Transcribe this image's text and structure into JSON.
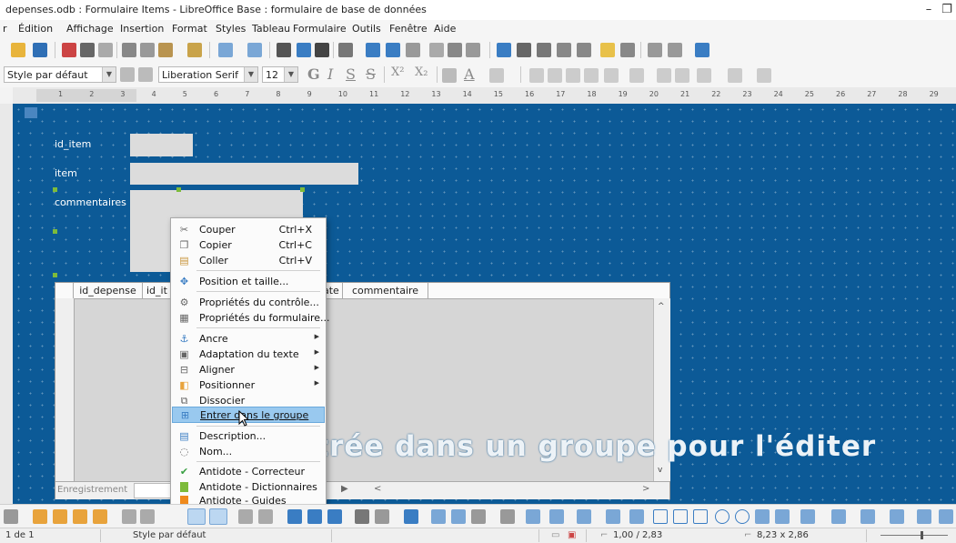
{
  "window": {
    "title": "depenses.odb : Formulaire Items - LibreOffice Base : formulaire de base de données"
  },
  "menubar": [
    "r",
    "Édition",
    "Affichage",
    "Insertion",
    "Format",
    "Styles",
    "Tableau",
    "Formulaire",
    "Outils",
    "Fenêtre",
    "Aide"
  ],
  "formatting": {
    "paragraph_style": "Style par défaut",
    "font_name": "Liberation Serif",
    "font_size": "12"
  },
  "ruler_ticks": [
    "1",
    "2",
    "3",
    "4",
    "5",
    "6",
    "7",
    "8",
    "9",
    "10",
    "11",
    "12",
    "13",
    "14",
    "15",
    "16",
    "17",
    "18",
    "19",
    "20",
    "21",
    "22",
    "23",
    "24",
    "25",
    "26",
    "27",
    "28",
    "29"
  ],
  "form": {
    "label_id_item": "id_item",
    "label_item": "item",
    "label_commentaires": "commentaires"
  },
  "grid": {
    "columns": [
      "id_depense",
      "id_it",
      "ate",
      "commentaire"
    ],
    "nav_label": "Enregistrement"
  },
  "context_menu": [
    {
      "label": "Couper",
      "shortcut": "Ctrl+X",
      "icon": "scissors-icon"
    },
    {
      "label": "Copier",
      "shortcut": "Ctrl+C",
      "icon": "copy-icon"
    },
    {
      "label": "Coller",
      "shortcut": "Ctrl+V",
      "icon": "paste-icon"
    },
    {
      "label": "Position et taille...",
      "icon": "position-size-icon"
    },
    {
      "label": "Propriétés du contrôle...",
      "icon": "control-properties-icon"
    },
    {
      "label": "Propriétés du formulaire...",
      "icon": "form-properties-icon"
    },
    {
      "label": "Ancre",
      "icon": "anchor-icon"
    },
    {
      "label": "Adaptation du texte",
      "icon": "text-wrap-icon"
    },
    {
      "label": "Aligner",
      "icon": "align-icon"
    },
    {
      "label": "Positionner",
      "icon": "arrange-icon"
    },
    {
      "label": "Dissocier",
      "icon": "ungroup-icon"
    },
    {
      "label": "Entrer dans le groupe",
      "icon": "enter-group-icon"
    },
    {
      "label": "Description...",
      "icon": "description-icon"
    },
    {
      "label": "Nom...",
      "icon": "name-icon"
    },
    {
      "label": "Antidote - Correcteur",
      "icon": "checkmark-icon"
    },
    {
      "label": "Antidote - Dictionnaires",
      "icon": "dictionary-icon"
    },
    {
      "label": "Antidote - Guides",
      "icon": "guides-icon"
    }
  ],
  "overlay_caption": "Entrée dans un groupe pour l'éditer",
  "status": {
    "page": "1 de 1",
    "style": "Style par défaut",
    "position": "1,00 / 2,83",
    "size": "8,23 x 2,86"
  },
  "colors": {
    "canvas": "#0c5a97",
    "highlight": "#99c9ef",
    "handle": "#7dbb3b"
  }
}
